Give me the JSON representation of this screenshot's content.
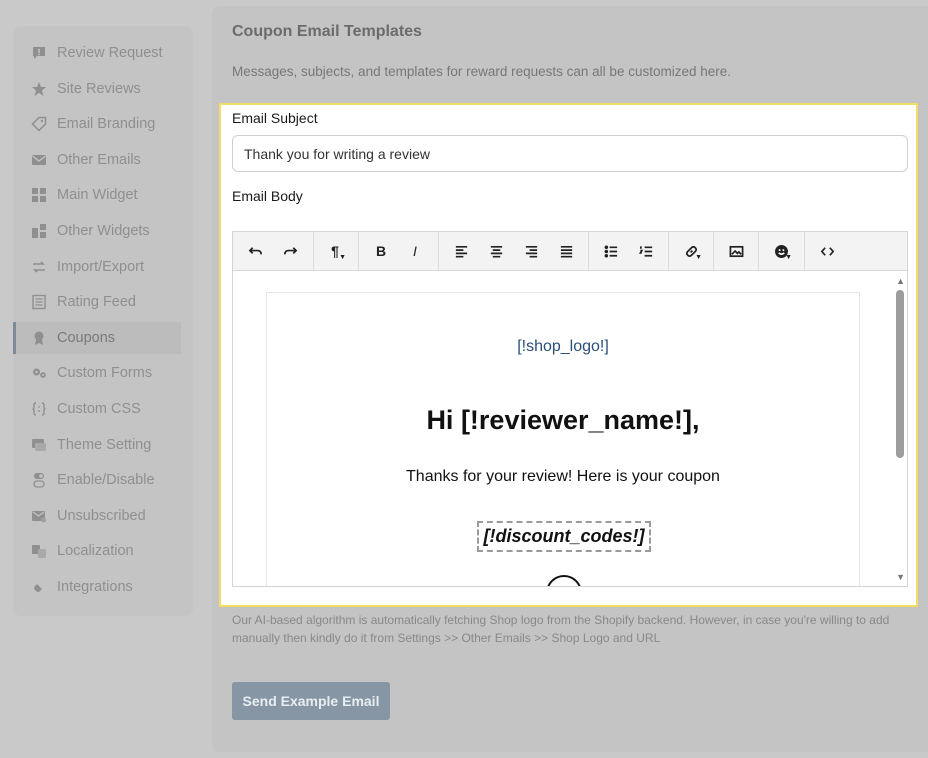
{
  "sidebar": {
    "items": [
      {
        "label": "Review Request",
        "icon": "message-alert-icon"
      },
      {
        "label": "Site Reviews",
        "icon": "star-icon"
      },
      {
        "label": "Email Branding",
        "icon": "tag-icon"
      },
      {
        "label": "Other Emails",
        "icon": "envelope-icon"
      },
      {
        "label": "Main Widget",
        "icon": "widget-grid-icon"
      },
      {
        "label": "Other Widgets",
        "icon": "widgets-icon"
      },
      {
        "label": "Import/Export",
        "icon": "swap-arrows-icon"
      },
      {
        "label": "Rating Feed",
        "icon": "list-icon"
      },
      {
        "label": "Coupons",
        "icon": "award-icon",
        "active": true
      },
      {
        "label": "Custom Forms",
        "icon": "cogs-icon"
      },
      {
        "label": "Custom CSS",
        "icon": "braces-icon"
      },
      {
        "label": "Theme Setting",
        "icon": "theme-icon"
      },
      {
        "label": "Enable/Disable",
        "icon": "toggle-icon"
      },
      {
        "label": "Unsubscribed",
        "icon": "mail-off-icon"
      },
      {
        "label": "Localization",
        "icon": "translate-icon"
      },
      {
        "label": "Integrations",
        "icon": "plug-icon"
      }
    ]
  },
  "main": {
    "title": "Coupon Email Templates",
    "description": "Messages, subjects, and templates for reward requests can all be customized here.",
    "subject_label": "Email Subject",
    "subject_value": "Thank you for writing a review",
    "body_label": "Email Body",
    "note": "Our AI-based algorithm is automatically fetching Shop logo from the Shopify backend. However, in case you're willing to add manually then kindly do it from Settings >> Other Emails >> Shop Logo and URL",
    "send_button": "Send Example Email"
  },
  "toolbar": {
    "paragraph_glyph": "¶",
    "bold_glyph": "B",
    "italic_glyph": "I"
  },
  "template": {
    "shop_logo": "[!shop_logo!]",
    "greeting": "Hi [!reviewer_name!],",
    "thanks": "Thanks for your review! Here is your coupon",
    "discount_codes": "[!discount_codes!]"
  },
  "colors": {
    "highlight_border": "#f2dc63",
    "button_bg": "#8696a4",
    "active_marker": "#7d8a99"
  }
}
